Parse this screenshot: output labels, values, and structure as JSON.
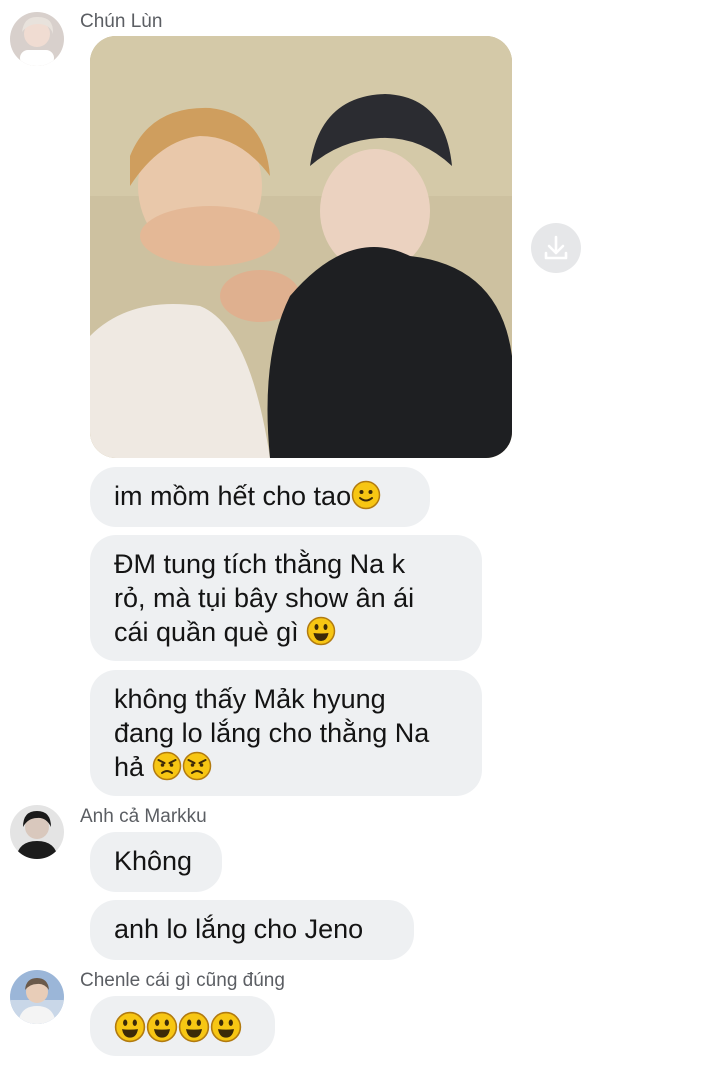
{
  "messages": [
    {
      "sender": "Chún Lùn",
      "avatar_icon": "avatar-chun-lun",
      "items": [
        {
          "kind": "photo",
          "icon": "photo-attachment",
          "action_icon": "download-icon"
        },
        {
          "kind": "text",
          "text": "im mồm hết cho tao",
          "emoji": [
            "slightly-smiling-face"
          ]
        },
        {
          "kind": "text",
          "lines": [
            "ĐM tung tích thằng Na k",
            "rỏ, mà tụi bây show ân ái",
            "cái quần què gì "
          ],
          "emoji": [
            "grinning-face"
          ]
        },
        {
          "kind": "text",
          "lines": [
            "không thấy Mảk hyung",
            "đang lo lắng cho thằng Na",
            "hả  "
          ],
          "emoji": [
            "angry-face",
            "angry-face"
          ]
        }
      ]
    },
    {
      "sender": "Anh cả Markku",
      "avatar_icon": "avatar-markku",
      "items": [
        {
          "kind": "text",
          "text": "Không"
        },
        {
          "kind": "text",
          "text": "anh lo lắng cho Jeno"
        }
      ]
    },
    {
      "sender": "Chenle cái gì cũng đúng",
      "avatar_icon": "avatar-chenle",
      "items": [
        {
          "kind": "text",
          "text": "",
          "emoji": [
            "grinning-face",
            "grinning-face",
            "grinning-face",
            "grinning-face"
          ]
        }
      ]
    }
  ],
  "colors": {
    "bubble": "#eef0f2",
    "text": "#141414",
    "sender_name": "#5b5e63",
    "emoji_yellow": "#f7c613",
    "emoji_outline": "#b27b10"
  }
}
